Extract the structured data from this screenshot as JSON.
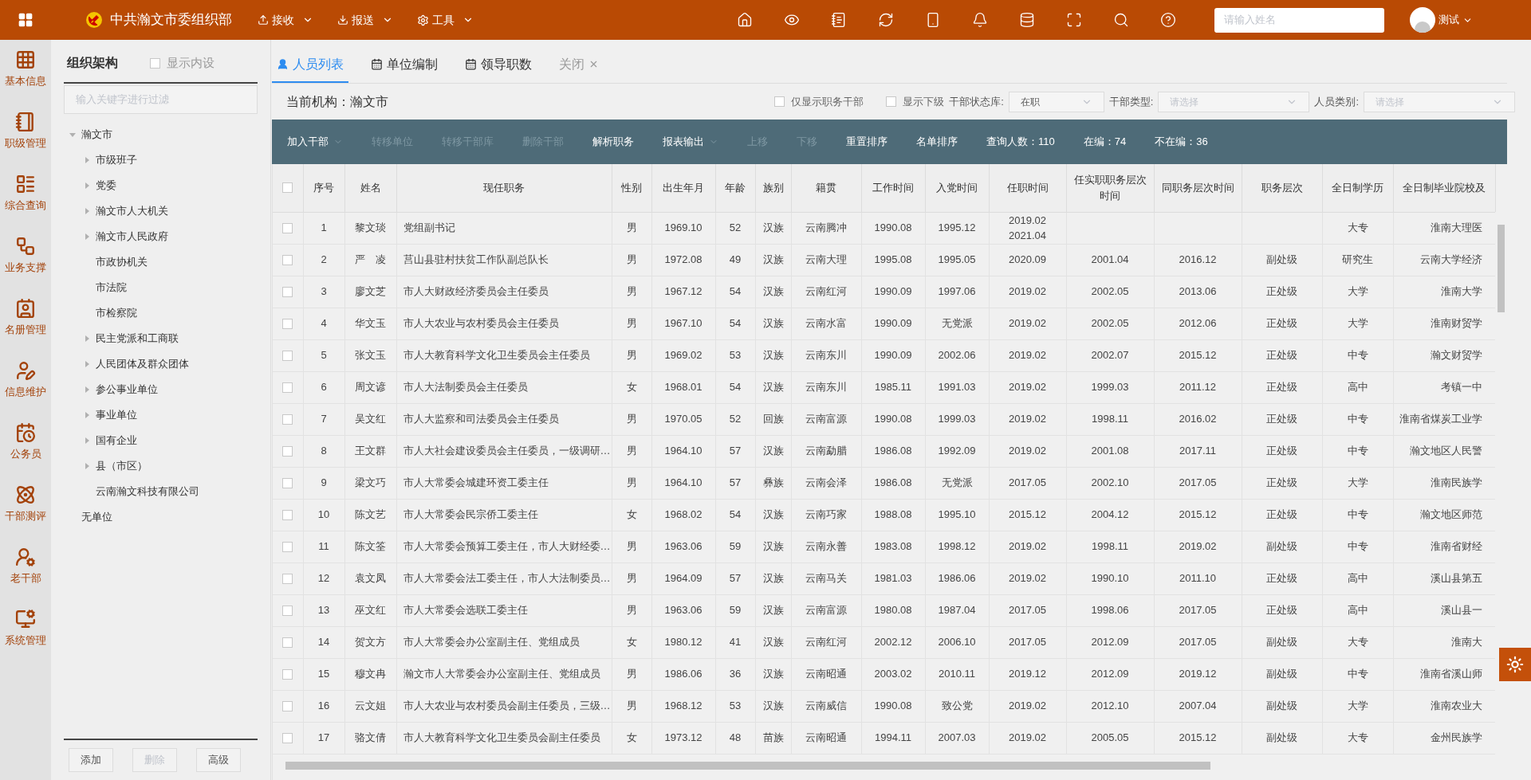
{
  "header": {
    "title": "中共瀚文市委组织部",
    "menus": [
      {
        "label": "接收"
      },
      {
        "label": "报送"
      },
      {
        "label": "工具"
      }
    ],
    "search": {
      "placeholder": "请输入姓名"
    },
    "user": "测试"
  },
  "rail": [
    {
      "label": "基本信息"
    },
    {
      "label": "职级管理"
    },
    {
      "label": "综合查询"
    },
    {
      "label": "业务支撑"
    },
    {
      "label": "名册管理"
    },
    {
      "label": "信息维护"
    },
    {
      "label": "公务员"
    },
    {
      "label": "干部测评"
    },
    {
      "label": "老干部"
    },
    {
      "label": "系统管理"
    }
  ],
  "tree_panel": {
    "title": "组织架构",
    "show_internal": {
      "label": "显示内设",
      "checked": false
    },
    "filter": {
      "placeholder": "输入关键字进行过滤"
    },
    "nodes": [
      {
        "label": "瀚文市",
        "kind": "branch",
        "expanded": true,
        "children": [
          {
            "label": "市级班子",
            "kind": "branch",
            "expanded": false
          },
          {
            "label": "党委",
            "kind": "branch",
            "expanded": false
          },
          {
            "label": "瀚文市人大机关",
            "kind": "branch",
            "expanded": false
          },
          {
            "label": "瀚文市人民政府",
            "kind": "branch",
            "expanded": false
          },
          {
            "label": "市政协机关",
            "kind": "leaf"
          },
          {
            "label": "市法院",
            "kind": "leaf"
          },
          {
            "label": "市检察院",
            "kind": "leaf"
          },
          {
            "label": "民主党派和工商联",
            "kind": "branch",
            "expanded": false
          },
          {
            "label": "人民团体及群众团体",
            "kind": "branch",
            "expanded": false
          },
          {
            "label": "参公事业单位",
            "kind": "branch",
            "expanded": false
          },
          {
            "label": "事业单位",
            "kind": "branch",
            "expanded": false
          },
          {
            "label": "国有企业",
            "kind": "branch",
            "expanded": false
          },
          {
            "label": "县（市区）",
            "kind": "branch",
            "expanded": false
          },
          {
            "label": "云南瀚文科技有限公司",
            "kind": "leaf"
          }
        ]
      },
      {
        "label": "无单位",
        "kind": "leaf"
      }
    ],
    "buttons": [
      {
        "label": "添加",
        "disabled": false
      },
      {
        "label": "删除",
        "disabled": true
      },
      {
        "label": "高级",
        "disabled": false
      }
    ]
  },
  "tabs": [
    {
      "label": "人员列表",
      "selected": true,
      "kind": "people"
    },
    {
      "label": "单位编制",
      "selected": false,
      "kind": "calendar"
    },
    {
      "label": "领导职数",
      "selected": false,
      "kind": "calendar"
    },
    {
      "label": "关闭",
      "selected": false,
      "kind": "close"
    }
  ],
  "filters": {
    "current_org_label": "当前机构：",
    "current_org": "瀚文市",
    "only_position": {
      "label": "仅显示职务干部",
      "checked": false
    },
    "show_sub": {
      "label": "显示下级",
      "checked": false
    },
    "selects": [
      {
        "label": "干部状态库:",
        "value": "在职"
      },
      {
        "label": "干部类型:",
        "placeholder": "请选择"
      },
      {
        "label": "人员类别:",
        "placeholder": "请选择"
      }
    ]
  },
  "toolbar": [
    {
      "kind": "button",
      "label": "加入干部",
      "disabled": false,
      "dropdown": true
    },
    {
      "kind": "button",
      "label": "转移单位",
      "disabled": true,
      "dropdown": false
    },
    {
      "kind": "button",
      "label": "转移干部库",
      "disabled": true,
      "dropdown": false
    },
    {
      "kind": "button",
      "label": "删除干部",
      "disabled": true,
      "dropdown": false
    },
    {
      "kind": "button",
      "label": "解析职务",
      "disabled": false,
      "dropdown": false
    },
    {
      "kind": "button",
      "label": "报表输出",
      "disabled": false,
      "dropdown": true
    },
    {
      "kind": "button",
      "label": "上移",
      "disabled": true,
      "dropdown": false
    },
    {
      "kind": "button",
      "label": "下移",
      "disabled": true,
      "dropdown": false
    },
    {
      "kind": "button",
      "label": "重置排序",
      "disabled": false,
      "dropdown": false
    },
    {
      "kind": "button",
      "label": "名单排序",
      "disabled": false,
      "dropdown": false
    },
    {
      "kind": "stat",
      "label": "查询人数：110"
    },
    {
      "kind": "stat",
      "label": "在编：74"
    },
    {
      "kind": "stat",
      "label": "不在编：36"
    }
  ],
  "table": {
    "select_all": {
      "checked": false
    },
    "columns": [
      "序号",
      "姓名",
      "现任职务",
      "性别",
      "出生年月",
      "年龄",
      "族别",
      "籍贯",
      "工作时间",
      "入党时间",
      "任职时间",
      "任实职职务层次时间",
      "同职务层次时间",
      "职务层次",
      "全日制学历",
      "全日制毕业院校及"
    ],
    "rows": [
      {
        "checked": false,
        "cells": [
          "1",
          "黎文琰",
          "党组副书记",
          "男",
          "1969.10",
          "52",
          "汉族",
          "云南腾冲",
          "1990.08",
          "1995.12",
          "2019.02\n2021.04",
          null,
          null,
          null,
          "大专",
          "淮南大理医"
        ]
      },
      {
        "checked": false,
        "cells": [
          "2",
          "严　凌",
          "莒山县驻村扶贫工作队副总队长",
          "男",
          "1972.08",
          "49",
          "汉族",
          "云南大理",
          "1995.08",
          "1995.05",
          "2020.09",
          "2001.04",
          "2016.12",
          "副处级",
          "研究生",
          "云南大学经济"
        ]
      },
      {
        "checked": false,
        "cells": [
          "3",
          "廖文芝",
          "市人大财政经济委员会主任委员",
          "男",
          "1967.12",
          "54",
          "汉族",
          "云南红河",
          "1990.09",
          "1997.06",
          "2019.02",
          "2002.05",
          "2013.06",
          "正处级",
          "大学",
          "淮南大学"
        ]
      },
      {
        "checked": false,
        "cells": [
          "4",
          "华文玉",
          "市人大农业与农村委员会主任委员",
          "男",
          "1967.10",
          "54",
          "汉族",
          "云南水富",
          "1990.09",
          "无党派",
          "2019.02",
          "2002.05",
          "2012.06",
          "正处级",
          "大学",
          "淮南财贸学"
        ]
      },
      {
        "checked": false,
        "cells": [
          "5",
          "张文玉",
          "市人大教育科学文化卫生委员会主任委员",
          "男",
          "1969.02",
          "53",
          "汉族",
          "云南东川",
          "1990.09",
          "2002.06",
          "2019.02",
          "2002.07",
          "2015.12",
          "正处级",
          "中专",
          "瀚文财贸学"
        ]
      },
      {
        "checked": false,
        "cells": [
          "6",
          "周文谚",
          "市人大法制委员会主任委员",
          "女",
          "1968.01",
          "54",
          "汉族",
          "云南东川",
          "1985.11",
          "1991.03",
          "2019.02",
          "1999.03",
          "2011.12",
          "正处级",
          "高中",
          "考镇一中"
        ]
      },
      {
        "checked": false,
        "cells": [
          "7",
          "吴文红",
          "市人大监察和司法委员会主任委员",
          "男",
          "1970.05",
          "52",
          "回族",
          "云南富源",
          "1990.08",
          "1999.03",
          "2019.02",
          "1998.11",
          "2016.02",
          "正处级",
          "中专",
          "淮南省煤炭工业学"
        ]
      },
      {
        "checked": false,
        "cells": [
          "8",
          "王文群",
          "市人大社会建设委员会主任委员，一级调研…",
          "男",
          "1964.10",
          "57",
          "汉族",
          "云南勐腊",
          "1986.08",
          "1992.09",
          "2019.02",
          "2001.08",
          "2017.11",
          "正处级",
          "中专",
          "瀚文地区人民警"
        ]
      },
      {
        "checked": false,
        "cells": [
          "9",
          "梁文巧",
          "市人大常委会城建环资工委主任",
          "男",
          "1964.10",
          "57",
          "彝族",
          "云南会泽",
          "1986.08",
          "无党派",
          "2017.05",
          "2002.10",
          "2017.05",
          "正处级",
          "大学",
          "淮南民族学"
        ]
      },
      {
        "checked": false,
        "cells": [
          "10",
          "陈文艺",
          "市人大常委会民宗侨工委主任",
          "女",
          "1968.02",
          "54",
          "汉族",
          "云南巧家",
          "1988.08",
          "1995.10",
          "2015.12",
          "2004.12",
          "2015.12",
          "正处级",
          "中专",
          "瀚文地区师范"
        ]
      },
      {
        "checked": false,
        "cells": [
          "11",
          "陈文筌",
          "市人大常委会预算工委主任，市人大财经委…",
          "男",
          "1963.06",
          "59",
          "汉族",
          "云南永善",
          "1983.08",
          "1998.12",
          "2019.02",
          "1998.11",
          "2019.02",
          "副处级",
          "中专",
          "淮南省财经"
        ]
      },
      {
        "checked": false,
        "cells": [
          "12",
          "袁文凤",
          "市人大常委会法工委主任，市人大法制委员…",
          "男",
          "1964.09",
          "57",
          "汉族",
          "云南马关",
          "1981.03",
          "1986.06",
          "2019.02",
          "1990.10",
          "2011.10",
          "正处级",
          "高中",
          "溪山县第五"
        ]
      },
      {
        "checked": false,
        "cells": [
          "13",
          "巫文红",
          "市人大常委会选联工委主任",
          "男",
          "1963.06",
          "59",
          "汉族",
          "云南富源",
          "1980.08",
          "1987.04",
          "2017.05",
          "1998.06",
          "2017.05",
          "正处级",
          "高中",
          "溪山县一"
        ]
      },
      {
        "checked": false,
        "cells": [
          "14",
          "贺文方",
          "市人大常委会办公室副主任、党组成员",
          "女",
          "1980.12",
          "41",
          "汉族",
          "云南红河",
          "2002.12",
          "2006.10",
          "2017.05",
          "2012.09",
          "2017.05",
          "副处级",
          "大专",
          "淮南大"
        ]
      },
      {
        "checked": false,
        "cells": [
          "15",
          "穆文冉",
          "瀚文市人大常委会办公室副主任、党组成员",
          "男",
          "1986.06",
          "36",
          "汉族",
          "云南昭通",
          "2003.02",
          "2010.11",
          "2019.12",
          "2012.09",
          "2019.12",
          "副处级",
          "中专",
          "淮南省溪山师"
        ]
      },
      {
        "checked": false,
        "cells": [
          "16",
          "云文姐",
          "市人大农业与农村委员会副主任委员，三级…",
          "男",
          "1968.12",
          "53",
          "汉族",
          "云南威信",
          "1990.08",
          "致公党",
          "2019.02",
          "2012.10",
          "2007.04",
          "副处级",
          "大学",
          "淮南农业大"
        ]
      },
      {
        "checked": false,
        "cells": [
          "17",
          "骆文倩",
          "市人大教育科学文化卫生委员会副主任委员",
          "女",
          "1973.12",
          "48",
          "苗族",
          "云南昭通",
          "1994.11",
          "2007.03",
          "2019.02",
          "2005.05",
          "2015.12",
          "副处级",
          "大专",
          "金州民族学"
        ]
      }
    ]
  }
}
